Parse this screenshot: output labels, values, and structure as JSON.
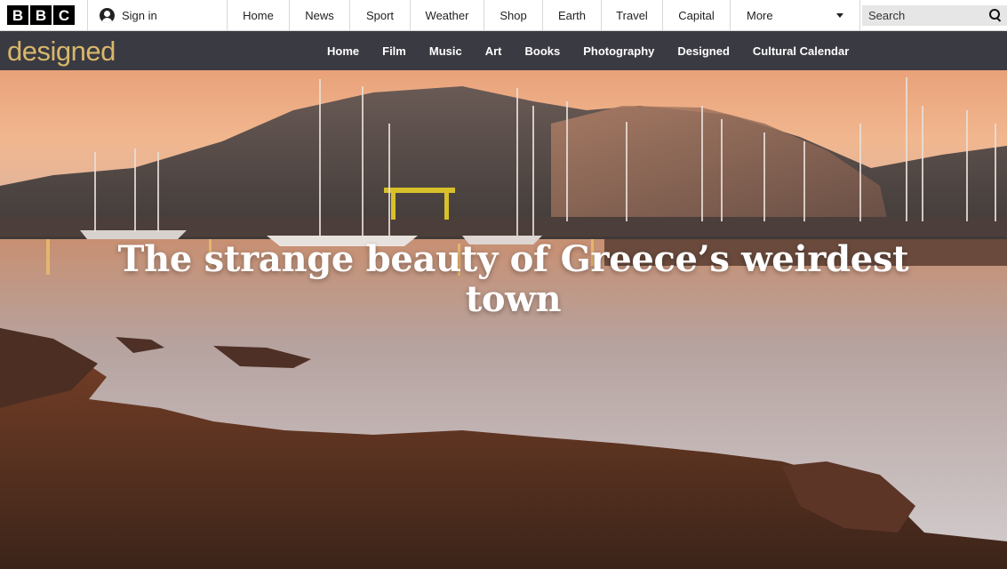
{
  "global_nav": {
    "logo_letters": [
      "B",
      "B",
      "C"
    ],
    "signin_label": "Sign in",
    "items": [
      "Home",
      "News",
      "Sport",
      "Weather",
      "Shop",
      "Earth",
      "Travel",
      "Capital"
    ],
    "more_label": "More",
    "search_placeholder": "Search"
  },
  "section": {
    "brand": "designed",
    "brand_color": "#d8b76a",
    "bar_color": "#3a3a42",
    "nav": [
      "Home",
      "Film",
      "Music",
      "Art",
      "Books",
      "Photography",
      "Designed",
      "Cultural Calendar"
    ]
  },
  "hero": {
    "title": "The strange beauty of Greece’s weirdest town"
  }
}
